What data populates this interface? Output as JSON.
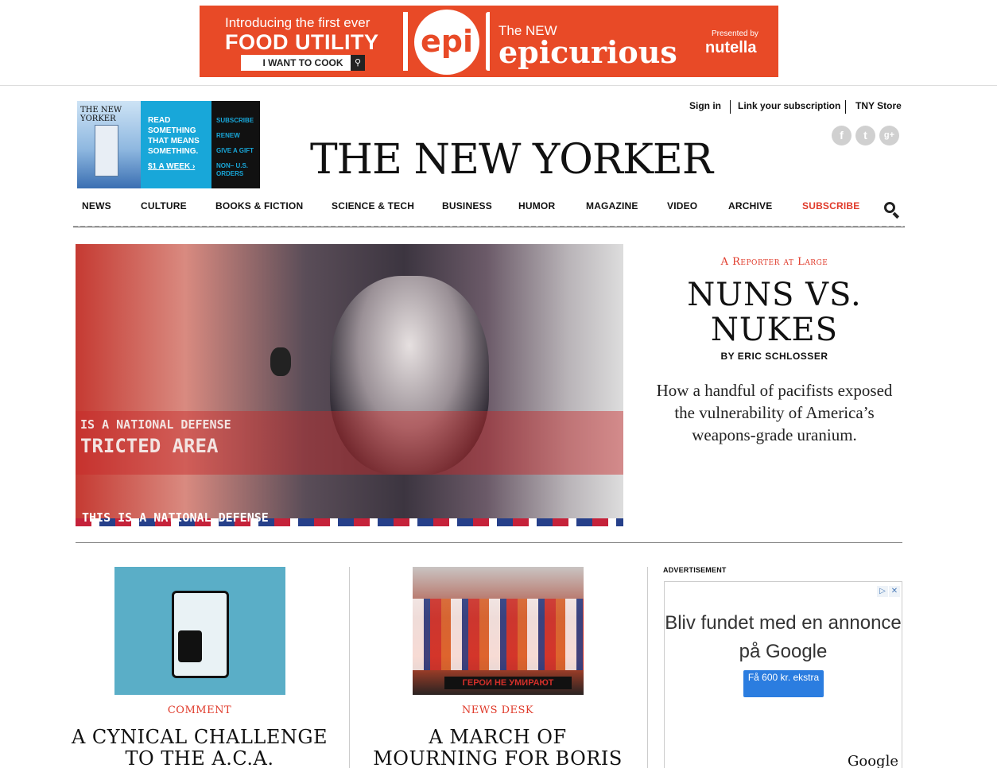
{
  "top_ad": {
    "line1": "Introducing the first ever",
    "line2": "FOOD UTILITY",
    "cta": "I WANT TO COOK",
    "logo": "epi",
    "right_line1": "The NEW",
    "right_line2": "epicurious",
    "presented_by": "Presented by",
    "sponsor": "nutella"
  },
  "subscribe_box": {
    "cover_title": "THE NEW YORKER",
    "pitch": [
      "READ",
      "SOMETHING",
      "THAT MEANS",
      "SOMETHING."
    ],
    "price": "$1 A WEEK ›",
    "links": [
      "SUBSCRIBE",
      "RENEW",
      "GIVE A GIFT",
      "NON– U.S. ORDERS"
    ]
  },
  "header": {
    "sign_in": "Sign in",
    "link_subscription": "Link your subscription",
    "store": "TNY Store",
    "social": {
      "facebook": "f",
      "twitter": "t",
      "google": "g+"
    },
    "logo": "THE NEW YORKER"
  },
  "nav": {
    "items": [
      "NEWS",
      "CULTURE",
      "BOOKS & FICTION",
      "SCIENCE & TECH",
      "BUSINESS",
      "HUMOR",
      "MAGAZINE",
      "VIDEO",
      "ARCHIVE"
    ],
    "subscribe": "SUBSCRIBE"
  },
  "hero": {
    "image_text1": "IS A NATIONAL DEFENSE",
    "image_text2": "TRICTED AREA",
    "image_text3": "THIS IS A NATIONAL DEFENSE",
    "kicker": "A Reporter at Large",
    "title": "NUNS VS. NUKES",
    "byline": "BY ERIC SCHLOSSER",
    "dek": "How a handful of pacifists exposed the vulnerability of America’s weapons-grade uranium."
  },
  "stories": [
    {
      "kicker": "COMMENT",
      "title": "A CYNICAL CHALLENGE TO THE A.C.A."
    },
    {
      "kicker": "NEWS DESK",
      "title": "A MARCH OF MOURNING FOR BORIS NEMTSOV",
      "image_banner": "ГЕРОИ НЕ УМИРАЮТ"
    }
  ],
  "side_ad": {
    "label": "ADVERTISEMENT",
    "message": "Bliv fundet med en annonce på Google",
    "button": "Få 600 kr. ekstra",
    "brand": "Google"
  },
  "colors": {
    "accent_red": "#e03a2a",
    "epi_orange": "#e84a27",
    "subscribe_blue": "#18a7d9"
  }
}
